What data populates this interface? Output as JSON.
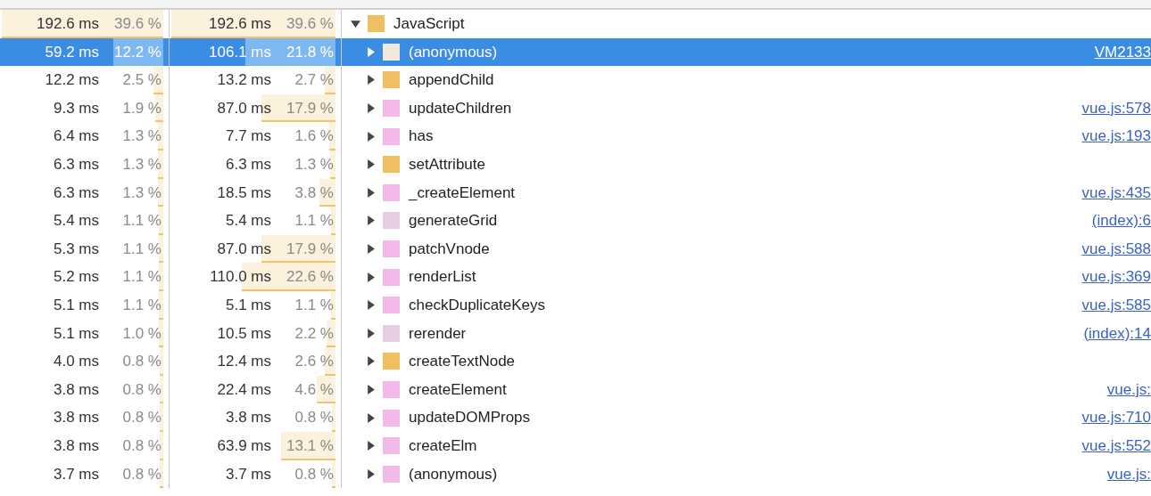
{
  "rows": [
    {
      "self": {
        "time": "192.6 ms",
        "percent": "39.6 %",
        "level": 1
      },
      "total": {
        "time": "192.6 ms",
        "percent": "39.6 %",
        "level": 1
      },
      "name": "JavaScript",
      "color": "#f0c060",
      "expanded": true,
      "selected": false,
      "children": [
        {
          "self": {
            "time": "59.2 ms",
            "percent": "12.2 %",
            "level": 0.31
          },
          "total": {
            "time": "106.1 ms",
            "percent": "21.8 %",
            "level": 0.55
          },
          "name": "(anonymous)",
          "color": "#f2e9dc",
          "expanded": false,
          "selected": true,
          "source": "VM2133"
        },
        {
          "self": {
            "time": "12.2 ms",
            "percent": "2.5 %",
            "level": 0.063
          },
          "total": {
            "time": "13.2 ms",
            "percent": "2.7 %",
            "level": 0.068
          },
          "name": "appendChild",
          "color": "#f0c060",
          "expanded": false,
          "selected": false
        },
        {
          "self": {
            "time": "9.3 ms",
            "percent": "1.9 %",
            "level": 0.048
          },
          "total": {
            "time": "87.0 ms",
            "percent": "17.9 %",
            "level": 0.452
          },
          "name": "updateChildren",
          "color": "#f3b8ea",
          "expanded": false,
          "selected": false,
          "source": "vue.js:578"
        },
        {
          "self": {
            "time": "6.4 ms",
            "percent": "1.3 %",
            "level": 0.033
          },
          "total": {
            "time": "7.7 ms",
            "percent": "1.6 %",
            "level": 0.04
          },
          "name": "has",
          "color": "#f3b8ea",
          "expanded": false,
          "selected": false,
          "source": "vue.js:193"
        },
        {
          "self": {
            "time": "6.3 ms",
            "percent": "1.3 %",
            "level": 0.033
          },
          "total": {
            "time": "6.3 ms",
            "percent": "1.3 %",
            "level": 0.033
          },
          "name": "setAttribute",
          "color": "#f0c060",
          "expanded": false,
          "selected": false
        },
        {
          "self": {
            "time": "6.3 ms",
            "percent": "1.3 %",
            "level": 0.033
          },
          "total": {
            "time": "18.5 ms",
            "percent": "3.8 %",
            "level": 0.096
          },
          "name": "_createElement",
          "color": "#f3b8ea",
          "expanded": false,
          "selected": false,
          "source": "vue.js:435"
        },
        {
          "self": {
            "time": "5.4 ms",
            "percent": "1.1 %",
            "level": 0.028
          },
          "total": {
            "time": "5.4 ms",
            "percent": "1.1 %",
            "level": 0.028
          },
          "name": "generateGrid",
          "color": "#e6cde3",
          "expanded": false,
          "selected": false,
          "source": "(index):6"
        },
        {
          "self": {
            "time": "5.3 ms",
            "percent": "1.1 %",
            "level": 0.028
          },
          "total": {
            "time": "87.0 ms",
            "percent": "17.9 %",
            "level": 0.452
          },
          "name": "patchVnode",
          "color": "#f3b8ea",
          "expanded": false,
          "selected": false,
          "source": "vue.js:588"
        },
        {
          "self": {
            "time": "5.2 ms",
            "percent": "1.1 %",
            "level": 0.028
          },
          "total": {
            "time": "110.0 ms",
            "percent": "22.6 %",
            "level": 0.571
          },
          "name": "renderList",
          "color": "#f3b8ea",
          "expanded": false,
          "selected": false,
          "source": "vue.js:369"
        },
        {
          "self": {
            "time": "5.1 ms",
            "percent": "1.1 %",
            "level": 0.028
          },
          "total": {
            "time": "5.1 ms",
            "percent": "1.1 %",
            "level": 0.028
          },
          "name": "checkDuplicateKeys",
          "color": "#f3b8ea",
          "expanded": false,
          "selected": false,
          "source": "vue.js:585"
        },
        {
          "self": {
            "time": "5.1 ms",
            "percent": "1.0 %",
            "level": 0.025
          },
          "total": {
            "time": "10.5 ms",
            "percent": "2.2 %",
            "level": 0.056
          },
          "name": "rerender",
          "color": "#e6cde3",
          "expanded": false,
          "selected": false,
          "source": "(index):14"
        },
        {
          "self": {
            "time": "4.0 ms",
            "percent": "0.8 %",
            "level": 0.02
          },
          "total": {
            "time": "12.4 ms",
            "percent": "2.6 %",
            "level": 0.066
          },
          "name": "createTextNode",
          "color": "#f0c060",
          "expanded": false,
          "selected": false
        },
        {
          "self": {
            "time": "3.8 ms",
            "percent": "0.8 %",
            "level": 0.02
          },
          "total": {
            "time": "22.4 ms",
            "percent": "4.6 %",
            "level": 0.116
          },
          "name": "createElement",
          "color": "#f3b8ea",
          "expanded": false,
          "selected": false,
          "source": "vue.js:"
        },
        {
          "self": {
            "time": "3.8 ms",
            "percent": "0.8 %",
            "level": 0.02
          },
          "total": {
            "time": "3.8 ms",
            "percent": "0.8 %",
            "level": 0.02
          },
          "name": "updateDOMProps",
          "color": "#f3b8ea",
          "expanded": false,
          "selected": false,
          "source": "vue.js:710"
        },
        {
          "self": {
            "time": "3.8 ms",
            "percent": "0.8 %",
            "level": 0.02
          },
          "total": {
            "time": "63.9 ms",
            "percent": "13.1 %",
            "level": 0.331
          },
          "name": "createElm",
          "color": "#f3b8ea",
          "expanded": false,
          "selected": false,
          "source": "vue.js:552"
        },
        {
          "self": {
            "time": "3.7 ms",
            "percent": "0.8 %",
            "level": 0.02
          },
          "total": {
            "time": "3.7 ms",
            "percent": "0.8 %",
            "level": 0.02
          },
          "name": "(anonymous)",
          "color": "#f3b8ea",
          "expanded": false,
          "selected": false,
          "source": "vue.js:"
        }
      ]
    }
  ]
}
